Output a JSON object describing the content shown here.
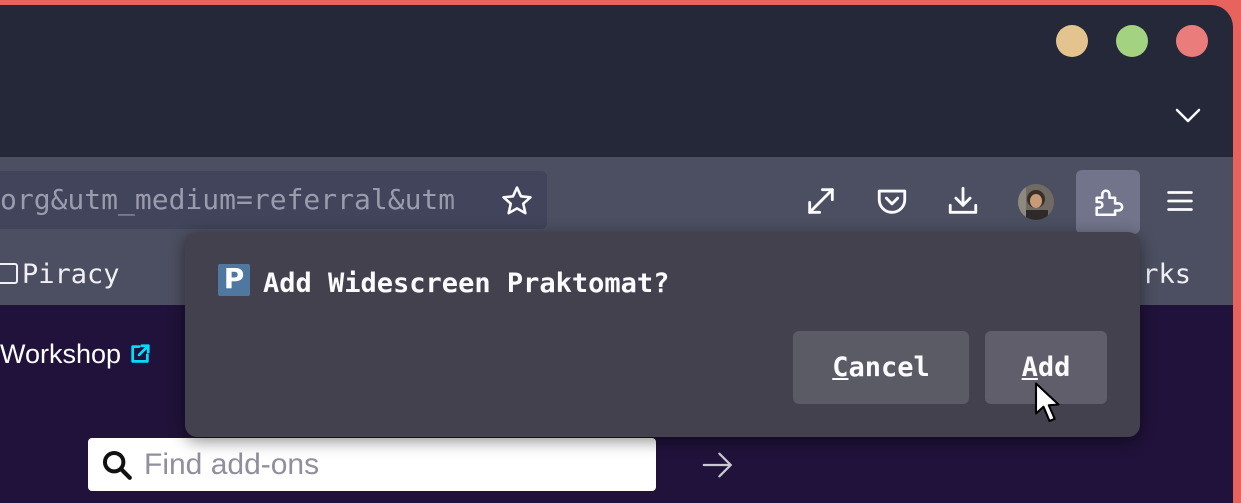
{
  "window": {
    "controls": [
      "minimize",
      "maximize",
      "close"
    ],
    "control_colors": [
      "#e3c48e",
      "#a3d280",
      "#ea7d7b"
    ]
  },
  "tabs": {
    "list_all_icon": "chevron-down-icon"
  },
  "urlbar": {
    "url_text": "org&utm_medium=referral&utm"
  },
  "bookmarks": {
    "left_folder": "Piracy",
    "right_label": "arks"
  },
  "page": {
    "workshop_link": "Workshop",
    "search_placeholder": "Find add-ons"
  },
  "dialog": {
    "title": "Add Widescreen Praktomat?",
    "icon_letter": "P",
    "cancel_label_accesskey": "C",
    "cancel_label_rest": "ancel",
    "add_label_accesskey": "A",
    "add_label_rest": "dd"
  },
  "colors": {
    "accent_link": "#00ddff",
    "frame": "#e8625e"
  }
}
